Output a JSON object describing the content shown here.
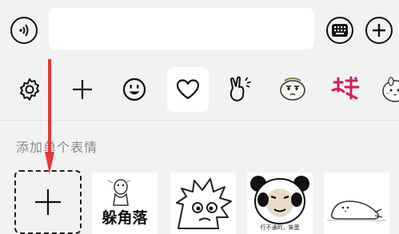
{
  "input": {
    "value": "",
    "placeholder": ""
  },
  "topbar": {
    "voice_icon": "voice-icon",
    "keyboard_icon": "keyboard-icon",
    "more_icon": "plus-icon"
  },
  "tabs": [
    {
      "icon": "gear-icon",
      "active": false
    },
    {
      "icon": "plus-icon",
      "active": false
    },
    {
      "icon": "smiley-icon",
      "active": false
    },
    {
      "icon": "heart-icon",
      "active": true
    },
    {
      "icon": "victory-hand-icon",
      "active": false
    },
    {
      "icon": "meme-face-icon",
      "active": false
    },
    {
      "icon": "sticker-pack-icon",
      "active": false
    },
    {
      "icon": "cute-face-icon",
      "active": false
    }
  ],
  "section": {
    "label": "添加单个表情"
  },
  "stickers": [
    {
      "name": "躲角落",
      "caption_text": "躲角落"
    },
    {
      "name": "spiky-face"
    },
    {
      "name": "panda-meme",
      "caption_text": "行不通的，笨蛋"
    },
    {
      "name": "lying-seal"
    }
  ],
  "colors": {
    "accent_arrow": "#e53935",
    "icon": "#111111",
    "background": "#f2f2f2"
  }
}
